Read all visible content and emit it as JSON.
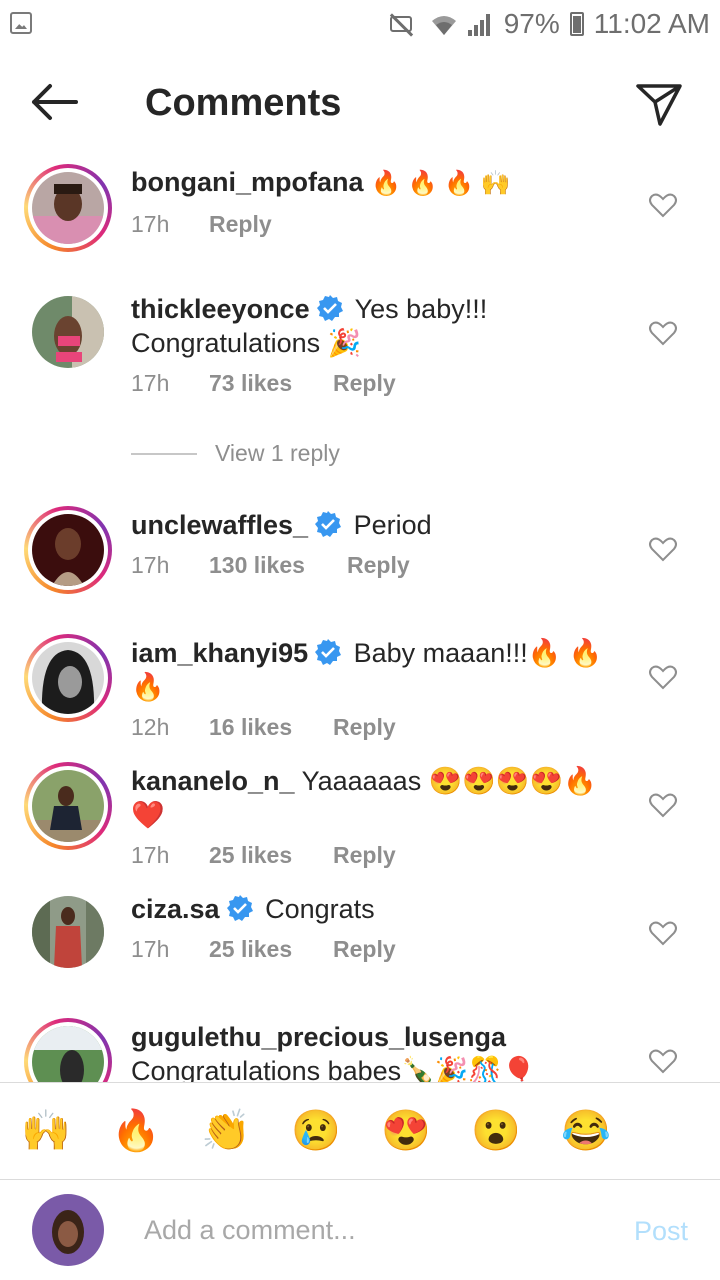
{
  "status_bar": {
    "battery": "97%",
    "time": "11:02 AM",
    "icons": [
      "image-notification-icon",
      "mute-icon",
      "wifi-icon",
      "signal-icon",
      "battery-icon"
    ]
  },
  "header": {
    "title": "Comments",
    "back_icon": "arrow-left-icon",
    "send_icon": "send-icon"
  },
  "comments": [
    {
      "username": "bongani_mpofana",
      "verified": false,
      "text": "🔥 🔥 🔥 🙌",
      "time": "17h",
      "likes": "",
      "reply": "Reply",
      "story_ring": true
    },
    {
      "username": "thickleeyonce",
      "verified": true,
      "text": "Yes baby!!!",
      "text2": "Congratulations 🎉",
      "time": "17h",
      "likes": "73 likes",
      "reply": "Reply",
      "story_ring": false
    },
    {
      "username": "unclewaffles_",
      "verified": true,
      "text": "Period",
      "time": "17h",
      "likes": "130 likes",
      "reply": "Reply",
      "story_ring": true
    },
    {
      "username": "iam_khanyi95",
      "verified": true,
      "text": "Baby maaan!!!🔥 🔥 🔥",
      "time": "12h",
      "likes": "16 likes",
      "reply": "Reply",
      "story_ring": true
    },
    {
      "username": "kananelo_n_",
      "verified": false,
      "text": "Yaaaaaas 😍😍😍😍🔥❤️",
      "time": "17h",
      "likes": "25 likes",
      "reply": "Reply",
      "story_ring": true
    },
    {
      "username": "ciza.sa",
      "verified": true,
      "text": "Congrats",
      "time": "17h",
      "likes": "25 likes",
      "reply": "Reply",
      "story_ring": false
    },
    {
      "username": "gugulethu_precious_lusenga",
      "verified": false,
      "text": "",
      "text2": "Congratulations babes🍾🎉🎊🎈",
      "time": "",
      "likes": "",
      "reply": "",
      "story_ring": true
    }
  ],
  "view_replies": "View 1 reply",
  "quick_emojis": [
    "🙌",
    "🔥",
    "👏",
    "😢",
    "😍",
    "😮",
    "😂"
  ],
  "composer": {
    "placeholder": "Add a comment...",
    "post_label": "Post"
  },
  "colors": {
    "verified": "#3897f0",
    "meta_text": "#8e8e8e",
    "post_disabled": "#b2dffc"
  }
}
